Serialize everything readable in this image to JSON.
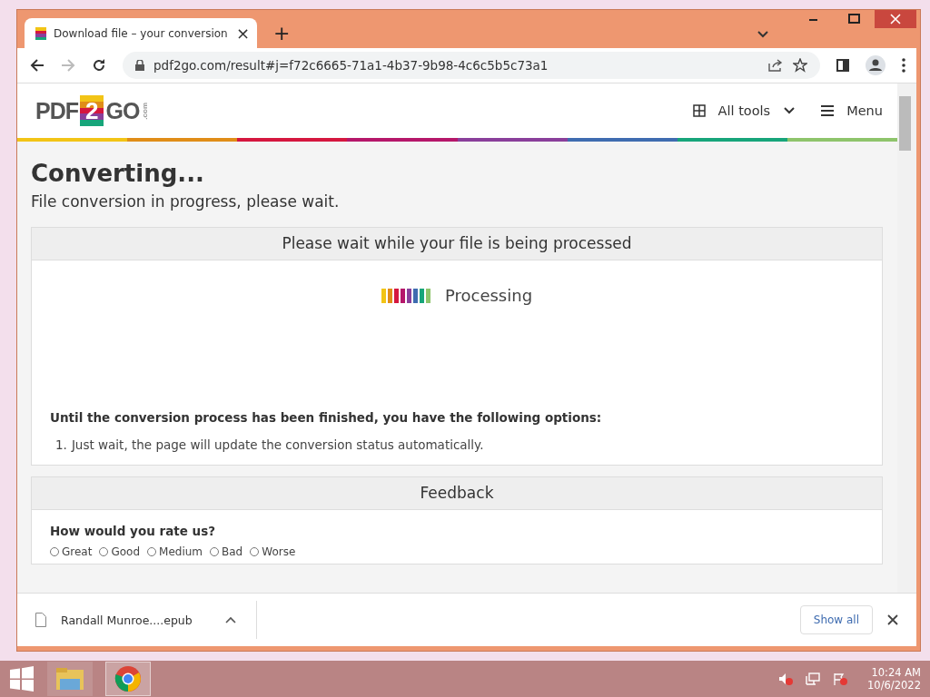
{
  "browser": {
    "tab": {
      "title": "Download file – your conversion",
      "close": "×"
    },
    "new_tab": "+",
    "url": "pdf2go.com/result#j=f72c6665-71a1-4b37-9b98-4c6c5b5c73a1"
  },
  "site": {
    "logo": {
      "left": "PDF",
      "badge": "2",
      "right": "GO",
      "suffix": ".com"
    },
    "all_tools": "All tools",
    "menu": "Menu",
    "stripe": [
      {
        "color": "#f2c416"
      },
      {
        "color": "#e08d18"
      },
      {
        "color": "#d5173f"
      },
      {
        "color": "#b5176a"
      },
      {
        "color": "#8a3f9b"
      },
      {
        "color": "#3f6cb0"
      },
      {
        "color": "#17a57a"
      },
      {
        "color": "#8ec46b"
      }
    ]
  },
  "page": {
    "title": "Converting...",
    "subtitle": "File conversion in progress, please wait.",
    "processing_panel": {
      "header": "Please wait while your file is being processed",
      "status": "Processing",
      "bars": [
        {
          "color": "#f2c416"
        },
        {
          "color": "#e08d18"
        },
        {
          "color": "#d5173f"
        },
        {
          "color": "#b5176a"
        },
        {
          "color": "#8a3f9b"
        },
        {
          "color": "#3f6cb0"
        },
        {
          "color": "#17a57a"
        },
        {
          "color": "#8ec46b"
        }
      ],
      "options_heading": "Until the conversion process has been finished, you have the following options:",
      "options": [
        {
          "number": "1.",
          "text": "Just wait, the page will update the conversion status automatically."
        }
      ]
    },
    "feedback_panel": {
      "header": "Feedback",
      "question": "How would you rate us?",
      "ratings": [
        {
          "label": "Great",
          "selected": false
        },
        {
          "label": "Good",
          "selected": false
        },
        {
          "label": "Medium",
          "selected": false
        },
        {
          "label": "Bad",
          "selected": false
        },
        {
          "label": "Worse",
          "selected": false
        }
      ]
    }
  },
  "downloads": {
    "file": "Randall Munroe....epub",
    "show_all": "Show all"
  },
  "taskbar": {
    "time": "10:24 AM",
    "date": "10/6/2022"
  }
}
